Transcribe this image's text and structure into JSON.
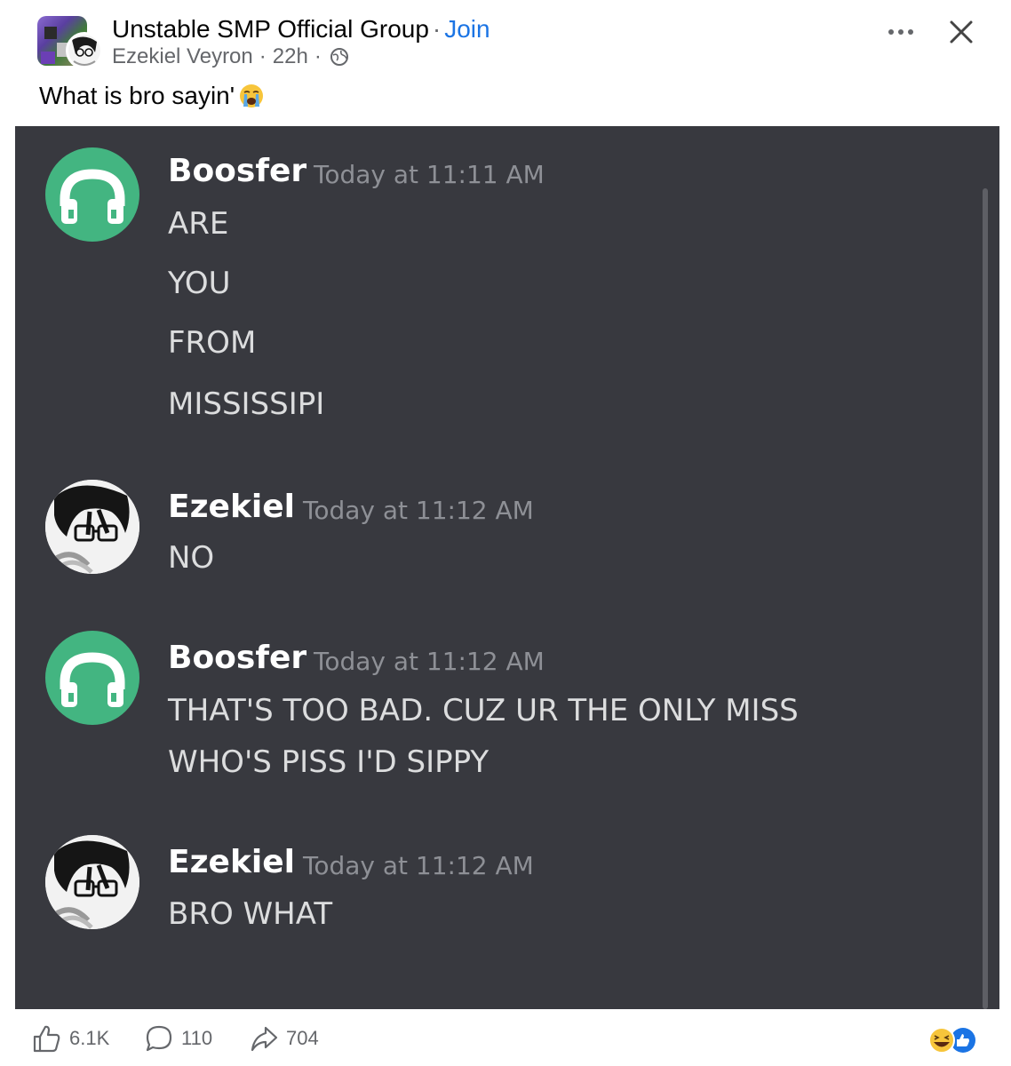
{
  "header": {
    "group_name": "Unstable SMP Official Group",
    "separator": "·",
    "join_label": "Join",
    "author_name": "Ezekiel Veyron",
    "time": "22h",
    "meta_separator": "·",
    "more_label": "•••",
    "close_label": "✕"
  },
  "post": {
    "text": "What is bro sayin'"
  },
  "discord": {
    "messages": [
      {
        "author": "Boosfer",
        "timestamp": "Today at 11:11 AM",
        "avatar": "headphones-icon",
        "lines": [
          "ARE",
          "YOU",
          "FROM",
          "MISSISSIPI"
        ]
      },
      {
        "author": "Ezekiel",
        "timestamp": "Today at 11:12 AM",
        "avatar": "anime-avatar",
        "lines": [
          "NO"
        ]
      },
      {
        "author": "Boosfer",
        "timestamp": "Today at 11:12 AM",
        "avatar": "headphones-icon",
        "lines": [
          "THAT'S TOO BAD. CUZ UR THE ONLY MISS",
          "WHO'S PISS I'D SIPPY"
        ]
      },
      {
        "author": "Ezekiel",
        "timestamp": "Today at 11:12 AM",
        "avatar": "anime-avatar",
        "lines": [
          "BRO WHAT"
        ]
      }
    ]
  },
  "footer": {
    "likes": "6.1K",
    "comments": "110",
    "shares": "704"
  },
  "colors": {
    "join_blue": "#1b74e4",
    "discord_bg": "#38393f",
    "boosfer_green": "#43b581",
    "muted_gray": "#65676b"
  }
}
